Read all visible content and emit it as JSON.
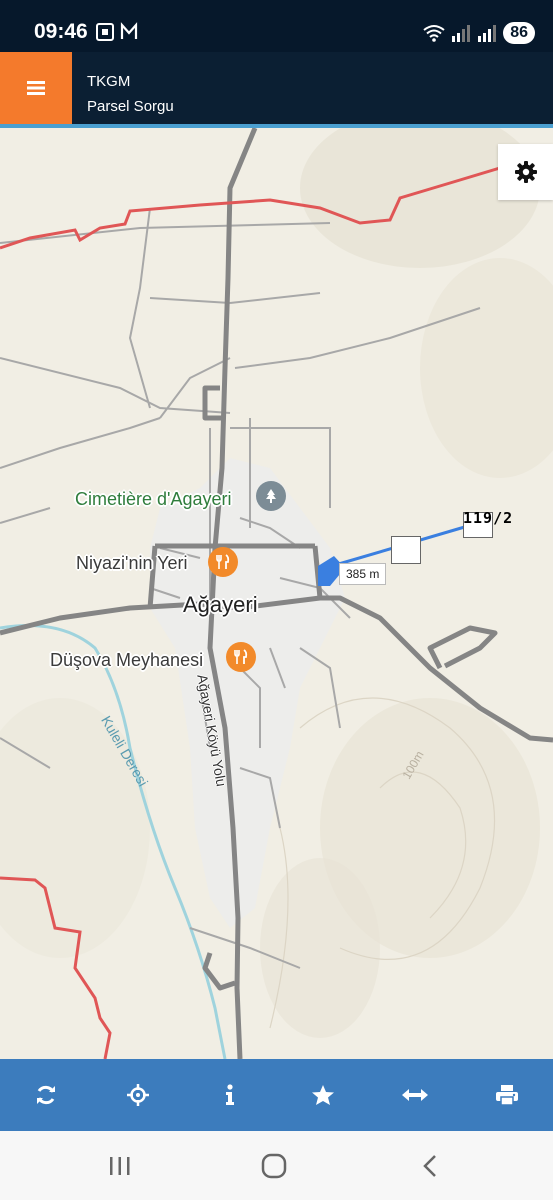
{
  "status_bar": {
    "time": "09:46",
    "battery": "86"
  },
  "header": {
    "title": "TKGM",
    "subtitle": "Parsel Sorgu"
  },
  "map": {
    "pois": {
      "cemetery": "Cimetière d'Agayeri",
      "restaurant1": "Niyazi'nin Yeri",
      "restaurant2": "Düşova Meyhanesi"
    },
    "town": "Ağayeri",
    "road": "Ağayeri Köyü Yolu",
    "stream": "Kuleli Deresi",
    "contour": "100m",
    "measure_distance": "385 m",
    "parcel": "119/2"
  },
  "toolbar": [
    "refresh-icon",
    "locate-icon",
    "info-icon",
    "star-icon",
    "measure-icon",
    "print-icon"
  ],
  "colors": {
    "accent_orange": "#f47a2c",
    "toolbar_blue": "#3c7cbd",
    "header_bg": "#0b1f33",
    "boundary_red": "#e05656",
    "measure_blue": "#3a7fe0"
  }
}
